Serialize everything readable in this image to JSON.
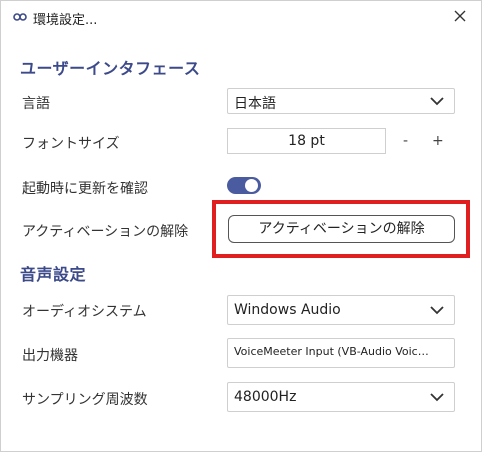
{
  "window": {
    "title": "環境設定...",
    "app_icon": "p-logo-icon",
    "close_icon": "close-icon"
  },
  "ui_section": {
    "title": "ユーザーインタフェース",
    "language_label": "言語",
    "language_value": "日本語",
    "font_size_label": "フォントサイズ",
    "font_size_value": "18 pt",
    "font_minus": "-",
    "font_plus": "+",
    "update_check_label": "起動時に更新を確認",
    "update_check_on": true,
    "deactivate_label": "アクティベーションの解除",
    "deactivate_button": "アクティベーションの解除"
  },
  "audio_section": {
    "title": "音声設定",
    "audio_system_label": "オーディオシステム",
    "audio_system_value": "Windows Audio",
    "output_device_label": "出力機器",
    "output_device_value": "VoiceMeeter Input (VB-Audio VoiceMeet...",
    "sampling_label": "サンプリング周波数",
    "sampling_value": "48000Hz"
  },
  "colors": {
    "accent": "#3c4a8a",
    "toggle": "#4a5ba0",
    "highlight": "#e02020"
  }
}
